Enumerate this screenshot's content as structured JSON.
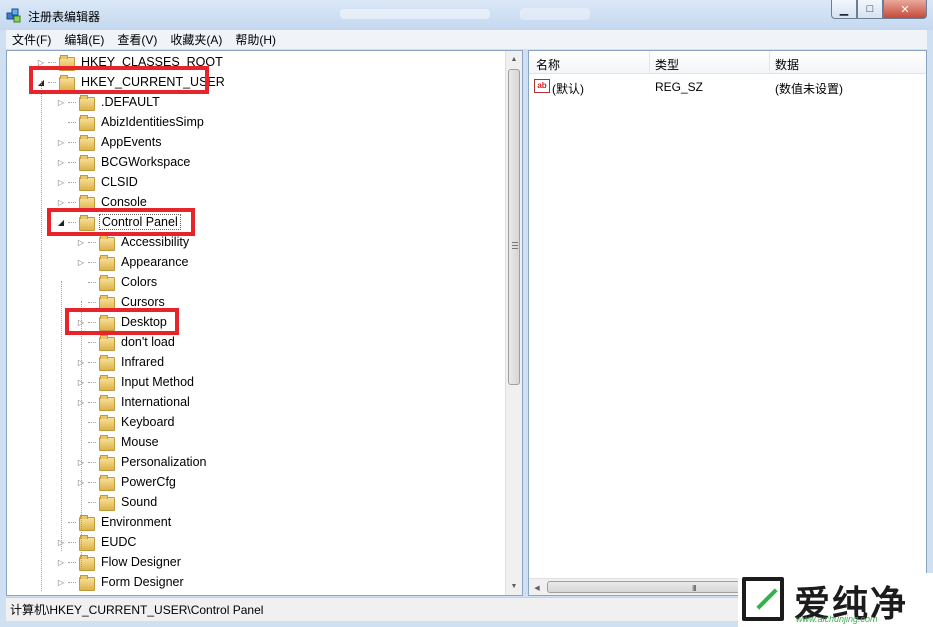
{
  "window": {
    "title": "注册表编辑器",
    "minimize": "▁",
    "maximize": "□",
    "close": "✕"
  },
  "menu": [
    "文件(F)",
    "编辑(E)",
    "查看(V)",
    "收藏夹(A)",
    "帮助(H)"
  ],
  "tree": {
    "items": [
      {
        "label": "HKEY_CLASSES_ROOT",
        "expander": "▷"
      },
      {
        "label": "HKEY_CURRENT_USER",
        "expander": "◢"
      },
      {
        "label": ".DEFAULT",
        "expander": "▷"
      },
      {
        "label": "AbizIdentitiesSimp",
        "expander": ""
      },
      {
        "label": "AppEvents",
        "expander": "▷"
      },
      {
        "label": "BCGWorkspace",
        "expander": "▷"
      },
      {
        "label": "CLSID",
        "expander": "▷"
      },
      {
        "label": "Console",
        "expander": "▷"
      },
      {
        "label": "Control Panel",
        "expander": "◢"
      },
      {
        "label": "Accessibility",
        "expander": "▷"
      },
      {
        "label": "Appearance",
        "expander": "▷"
      },
      {
        "label": "Colors",
        "expander": ""
      },
      {
        "label": "Cursors",
        "expander": ""
      },
      {
        "label": "Desktop",
        "expander": "▷"
      },
      {
        "label": "don't load",
        "expander": ""
      },
      {
        "label": "Infrared",
        "expander": "▷"
      },
      {
        "label": "Input Method",
        "expander": "▷"
      },
      {
        "label": "International",
        "expander": "▷"
      },
      {
        "label": "Keyboard",
        "expander": ""
      },
      {
        "label": "Mouse",
        "expander": ""
      },
      {
        "label": "Personalization",
        "expander": "▷"
      },
      {
        "label": "PowerCfg",
        "expander": "▷"
      },
      {
        "label": "Sound",
        "expander": ""
      },
      {
        "label": "Environment",
        "expander": ""
      },
      {
        "label": "EUDC",
        "expander": "▷"
      },
      {
        "label": "Flow Designer",
        "expander": "▷"
      },
      {
        "label": "Form Designer",
        "expander": "▷"
      }
    ]
  },
  "list": {
    "columns": [
      "名称",
      "类型",
      "数据"
    ],
    "rows": [
      {
        "name": "(默认)",
        "type": "REG_SZ",
        "data": "(数值未设置)",
        "icon": "ab"
      }
    ]
  },
  "scroll": {
    "up": "▲",
    "down": "▼",
    "left": "◀",
    "right": "▶",
    "grip": "III"
  },
  "status": "计算机\\HKEY_CURRENT_USER\\Control Panel",
  "watermark": {
    "brand": "爱纯净",
    "url": "www.aichunjing.com"
  },
  "colors": {
    "highlight_box": "#e8232a"
  }
}
